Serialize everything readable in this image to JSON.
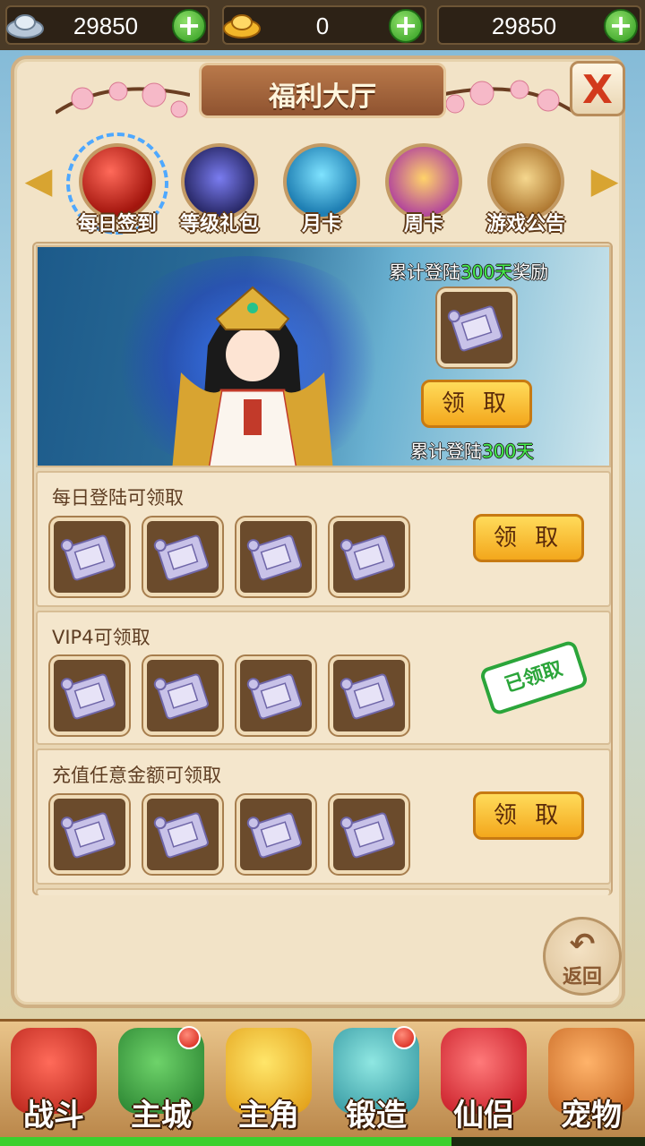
{
  "currency": [
    {
      "icon": "silver-ingot-icon",
      "value": "29850"
    },
    {
      "icon": "gold-ingot-icon",
      "value": "0"
    },
    {
      "icon": "coin-icon",
      "value": "29850"
    }
  ],
  "panel": {
    "title": "福利大厅",
    "close_label": "X"
  },
  "tabs": [
    {
      "label": "每日签到",
      "icon": "red-orb-icon",
      "selected": true
    },
    {
      "label": "等级礼包",
      "icon": "constellation-icon",
      "selected": false
    },
    {
      "label": "月卡",
      "icon": "dragon-wings-icon",
      "selected": false
    },
    {
      "label": "周卡",
      "icon": "medal-icon",
      "selected": false
    },
    {
      "label": "游戏公告",
      "icon": "scroll-icon",
      "selected": false
    }
  ],
  "banner": {
    "reward_title_pre": "累计登陆",
    "reward_title_days": "300天",
    "reward_title_post": "奖励",
    "claim_label": "领 取",
    "progress_pre": "累计登陆",
    "progress_days": "300天"
  },
  "rows": [
    {
      "title": "每日登陆可领取",
      "items": 4,
      "action": "领 取",
      "claimed": false
    },
    {
      "title": "VIP4可领取",
      "items": 4,
      "action": "已领取",
      "claimed": true
    },
    {
      "title": "充值任意金额可领取",
      "items": 4,
      "action": "领 取",
      "claimed": false
    }
  ],
  "back_label": "返回",
  "bottom_nav": [
    {
      "label": "战斗",
      "icon": "battle-icon",
      "badge": false
    },
    {
      "label": "主城",
      "icon": "city-icon",
      "badge": true
    },
    {
      "label": "主角",
      "icon": "hero-icon",
      "badge": false
    },
    {
      "label": "锻造",
      "icon": "hammer-icon",
      "badge": true
    },
    {
      "label": "仙侣",
      "icon": "heart-icon",
      "badge": false
    },
    {
      "label": "宠物",
      "icon": "monkey-icon",
      "badge": false
    }
  ],
  "colors": {
    "accent_green": "#44f04a",
    "button_gold": "#f3a71c",
    "stamp_green": "#2ba53a"
  }
}
